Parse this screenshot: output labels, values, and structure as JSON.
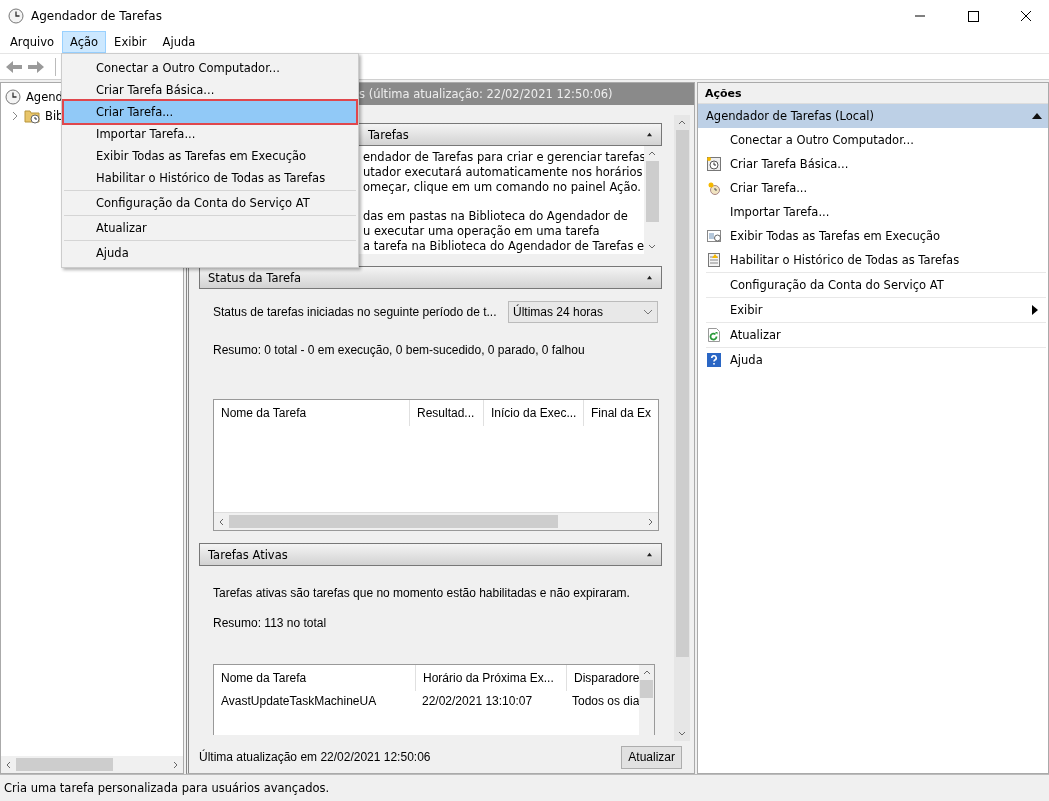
{
  "window": {
    "title": "Agendador de Tarefas"
  },
  "menu_bar": [
    {
      "label": "Arquivo",
      "selected": false
    },
    {
      "label": "Ação",
      "selected": true
    },
    {
      "label": "Exibir",
      "selected": false
    },
    {
      "label": "Ajuda",
      "selected": false
    }
  ],
  "open_menu": {
    "groups": [
      [
        {
          "label": "Conectar a Outro Computador...",
          "selected": false
        },
        {
          "label": "Criar Tarefa Básica...",
          "selected": false
        },
        {
          "label": "Criar Tarefa...",
          "selected": true
        },
        {
          "label": "Importar Tarefa...",
          "selected": false
        },
        {
          "label": "Exibir Todas as Tarefas em Execução",
          "selected": false
        },
        {
          "label": "Habilitar o Histórico de Todas as Tarefas",
          "selected": false
        }
      ],
      [
        {
          "label": "Configuração da Conta do Serviço AT",
          "selected": false
        }
      ],
      [
        {
          "label": "Atualizar",
          "selected": false
        }
      ],
      [
        {
          "label": "Ajuda",
          "selected": false
        }
      ]
    ]
  },
  "tree": [
    {
      "label": "Agend",
      "children": [
        {
          "label": "Bib",
          "expanded": false
        }
      ]
    }
  ],
  "center": {
    "header": "s (última atualização: 22/02/2021 12:50:06)",
    "sections": [
      {
        "kind": "overview",
        "title": "Tarefas",
        "expanded": true,
        "paragraphs": [
          [
            "endador de Tarefas para criar e gerenciar tarefas",
            "utador executará automaticamente nos horários",
            "omeçar, clique em um comando no painel Ação."
          ],
          [
            "das em pastas na Biblioteca do Agendador de",
            "u executar uma operação em uma tarefa",
            "a tarefa na Biblioteca do Agendador de Tarefas e"
          ]
        ]
      },
      {
        "kind": "status",
        "title": "Status da Tarefa",
        "expanded": true,
        "period_label": "Status de tarefas iniciadas no seguinte período de t...",
        "period_value": "Últimas 24 horas",
        "summary": "Resumo: 0 total - 0 em execução, 0 bem-sucedido, 0 parado, 0 falhou",
        "table": {
          "columns": [
            "Nome da Tarefa",
            "Resultad...",
            "Início da Exec...",
            "Final da Ex"
          ]
        }
      },
      {
        "kind": "active",
        "title": "Tarefas Ativas",
        "expanded": true,
        "description": "Tarefas ativas são tarefas que no momento estão habilitadas e não expiraram.",
        "summary": "Resumo: 113 no total",
        "table": {
          "columns": [
            "Nome da Tarefa",
            "Horário da Próxima Ex...",
            "Disparadore"
          ],
          "rows": [
            [
              "AvastUpdateTaskMachineUA",
              "22/02/2021 13:10:07",
              "Todos os dia"
            ]
          ]
        }
      }
    ],
    "last_update": "Última atualização em 22/02/2021 12:50:06",
    "refresh_button": "Atualizar"
  },
  "actions": {
    "title": "Ações",
    "group": {
      "label": "Agendador de Tarefas (Local)",
      "expanded": true
    },
    "groups": [
      [
        {
          "kind": "plain",
          "label": "Conectar a Outro Computador..."
        },
        {
          "kind": "basic-task",
          "label": "Criar Tarefa Básica..."
        },
        {
          "kind": "task",
          "label": "Criar Tarefa..."
        },
        {
          "kind": "plain",
          "label": "Importar Tarefa..."
        },
        {
          "kind": "running",
          "label": "Exibir Todas as Tarefas em Execução"
        },
        {
          "kind": "history",
          "label": "Habilitar o Histórico de Todas as Tarefas"
        }
      ],
      [
        {
          "kind": "plain",
          "label": "Configuração da Conta do Serviço AT"
        }
      ],
      [
        {
          "kind": "submenu",
          "label": "Exibir"
        }
      ],
      [
        {
          "kind": "refresh",
          "label": "Atualizar"
        }
      ],
      [
        {
          "kind": "help",
          "label": "Ajuda"
        }
      ]
    ]
  },
  "status_bar": "Cria uma tarefa personalizada para usuários avançados."
}
